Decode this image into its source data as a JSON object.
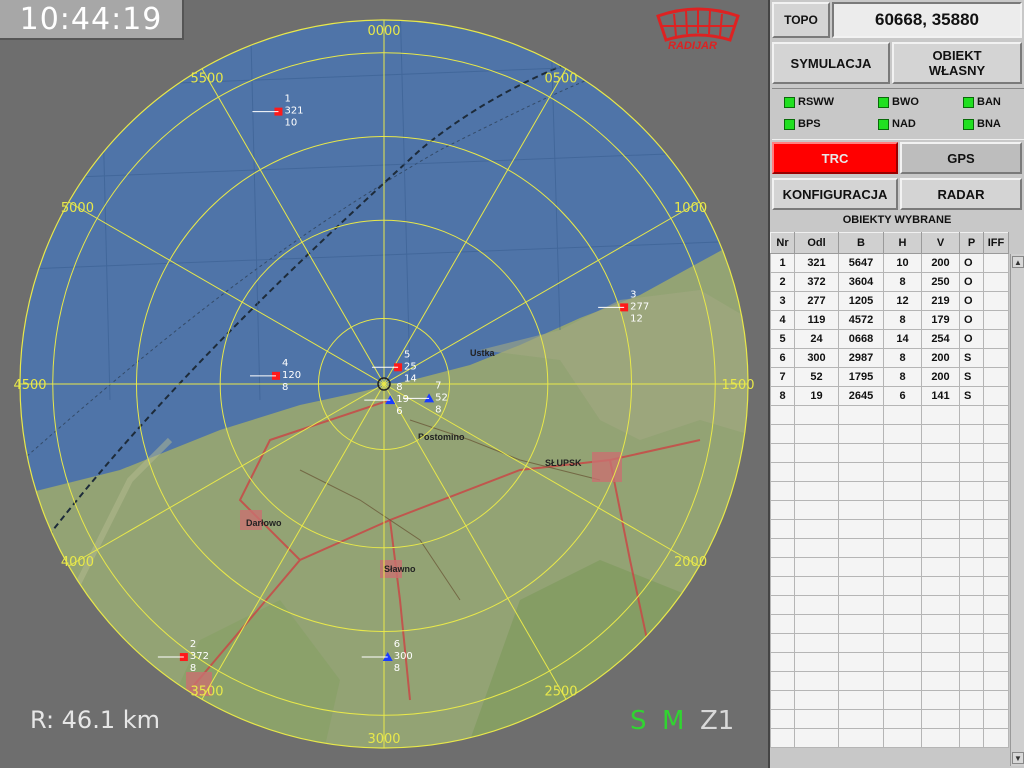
{
  "clock": "10:44:19",
  "range_label": "R: 46.1 km",
  "modes": {
    "s": "S",
    "m": "M",
    "z": "Z1"
  },
  "logo_text": "RADIJAR",
  "bearing_labels": [
    {
      "text": "0000",
      "deg": 0
    },
    {
      "text": "0500",
      "deg": 30
    },
    {
      "text": "1000",
      "deg": 60
    },
    {
      "text": "1500",
      "deg": 90
    },
    {
      "text": "2000",
      "deg": 120
    },
    {
      "text": "2500",
      "deg": 150
    },
    {
      "text": "3000",
      "deg": 180
    },
    {
      "text": "3500",
      "deg": 210
    },
    {
      "text": "4000",
      "deg": 240
    },
    {
      "text": "4500",
      "deg": 270
    },
    {
      "text": "5000",
      "deg": 300
    },
    {
      "text": "5500",
      "deg": 330
    }
  ],
  "map_labels": [
    "Ustka",
    "SŁUPSK",
    "Darłowo",
    "Sławno",
    "Postomino"
  ],
  "radar_targets": [
    {
      "nr": "1",
      "odl": "321",
      "h": "10",
      "type": "O"
    },
    {
      "nr": "2",
      "odl": "372",
      "h": "8",
      "type": "O"
    },
    {
      "nr": "3",
      "odl": "277",
      "h": "12",
      "type": "O"
    },
    {
      "nr": "4",
      "odl": "120",
      "h": "8",
      "type": "O"
    },
    {
      "nr": "5",
      "odl": "25",
      "h": "14",
      "type": "O"
    },
    {
      "nr": "6",
      "odl": "300",
      "h": "8",
      "type": "S"
    },
    {
      "nr": "7",
      "odl": "52",
      "h": "8",
      "type": "S"
    },
    {
      "nr": "8",
      "odl": "19",
      "h": "6",
      "type": "S"
    }
  ],
  "panel": {
    "topo_label": "TOPO",
    "topo_value": "60668, 35880",
    "symulacja": "SYMULACJA",
    "obiekt_line1": "OBIEKT",
    "obiekt_line2": "WŁASNY",
    "indicators": [
      "RSWW",
      "BWO",
      "BAN",
      "BPS",
      "NAD",
      "BNA"
    ],
    "trc": "TRC",
    "gps": "GPS",
    "konfiguracja": "KONFIGURACJA",
    "radar": "RADAR",
    "table_title": "OBIEKTY WYBRANE",
    "columns": [
      "Nr",
      "Odl",
      "B",
      "H",
      "V",
      "P",
      "IFF"
    ],
    "rows": [
      [
        "1",
        "321",
        "5647",
        "10",
        "200",
        "O",
        ""
      ],
      [
        "2",
        "372",
        "3604",
        "8",
        "250",
        "O",
        ""
      ],
      [
        "3",
        "277",
        "1205",
        "12",
        "219",
        "O",
        ""
      ],
      [
        "4",
        "119",
        "4572",
        "8",
        "179",
        "O",
        ""
      ],
      [
        "5",
        "24",
        "0668",
        "14",
        "254",
        "O",
        ""
      ],
      [
        "6",
        "300",
        "2987",
        "8",
        "200",
        "S",
        ""
      ],
      [
        "7",
        "52",
        "1795",
        "8",
        "200",
        "S",
        ""
      ],
      [
        "8",
        "19",
        "2645",
        "6",
        "141",
        "S",
        ""
      ]
    ]
  },
  "colors": {
    "accent_red": "#ff0000",
    "led_green": "#21e021",
    "ring_yellow": "#e8e84a",
    "sea": "#4f74a8",
    "land": "#8a9a6a"
  }
}
